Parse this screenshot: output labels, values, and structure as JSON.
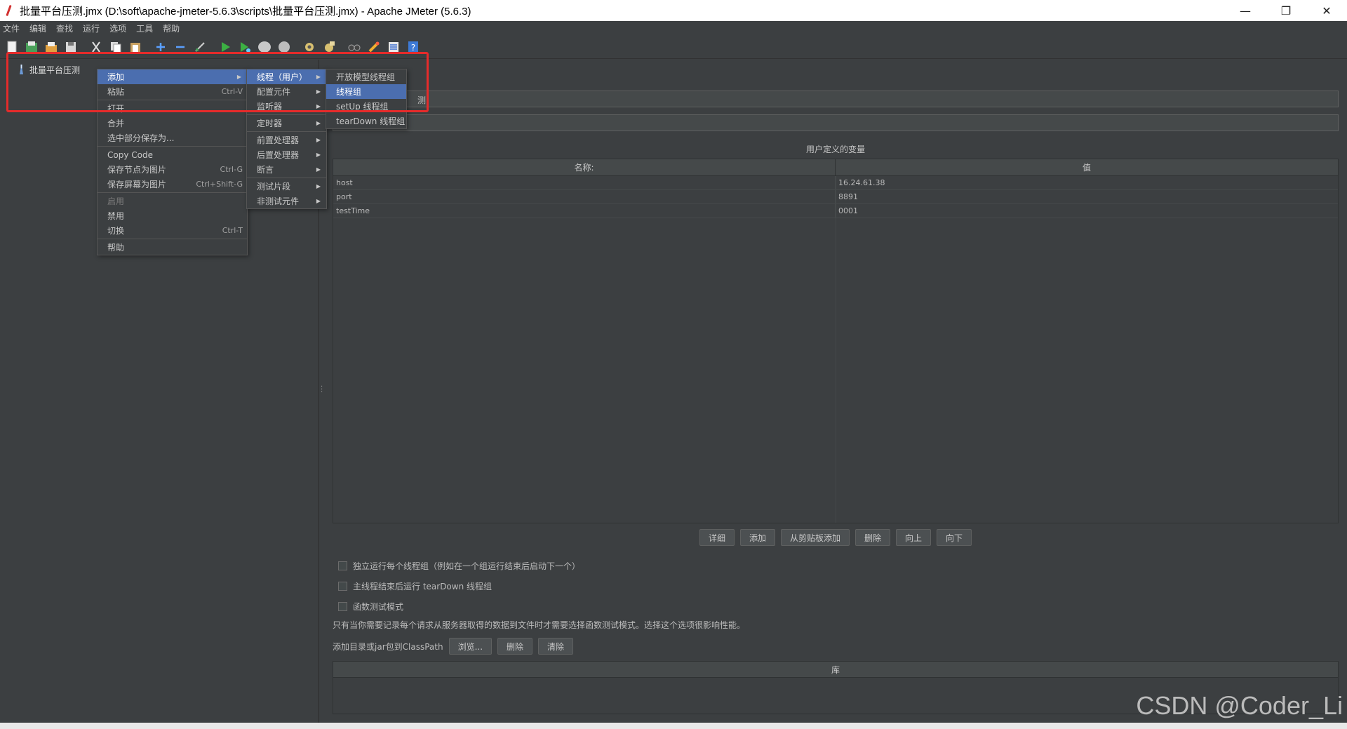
{
  "window": {
    "title": "批量平台压测.jmx (D:\\soft\\apache-jmeter-5.6.3\\scripts\\批量平台压测.jmx) - Apache JMeter (5.6.3)",
    "controls": {
      "minimize": "—",
      "restore": "❐",
      "close": "✕"
    }
  },
  "menubar": [
    "文件",
    "编辑",
    "查找",
    "运行",
    "选项",
    "工具",
    "帮助"
  ],
  "tree": {
    "root_label": "批量平台压测"
  },
  "test_plan": {
    "name_value": "测",
    "section_title": "用户定义的变量",
    "columns": [
      "名称:",
      "值"
    ],
    "rows": [
      {
        "name": "host",
        "value": "16.24.61.38"
      },
      {
        "name": "port",
        "value": "8891"
      },
      {
        "name": "testTime",
        "value": "0001"
      }
    ],
    "buttons": [
      "详细",
      "添加",
      "从剪贴板添加",
      "删除",
      "向上",
      "向下"
    ],
    "checkboxes": [
      "独立运行每个线程组（例如在一个组运行结束后启动下一个）",
      "主线程结束后运行 tearDown 线程组",
      "函数测试模式"
    ],
    "note": "只有当你需要记录每个请求从服务器取得的数据到文件时才需要选择函数测试模式。选择这个选项很影响性能。",
    "classpath_label": "添加目录或jar包到ClassPath",
    "classpath_buttons": [
      "浏览...",
      "删除",
      "清除"
    ],
    "library_header": "库"
  },
  "context_menu": {
    "items": [
      {
        "label": "添加",
        "shortcut": "",
        "selected": true,
        "submenu": true
      },
      {
        "label": "粘贴",
        "shortcut": "Ctrl-V"
      },
      {
        "label": "打开...",
        "shortcut": ""
      },
      {
        "label": "合并",
        "shortcut": ""
      },
      {
        "label": "选中部分保存为...",
        "shortcut": ""
      },
      {
        "label": "Copy Code",
        "shortcut": ""
      },
      {
        "label": "保存节点为图片",
        "shortcut": "Ctrl-G"
      },
      {
        "label": "保存屏幕为图片",
        "shortcut": "Ctrl+Shift-G"
      },
      {
        "label": "启用",
        "shortcut": "",
        "disabled": true
      },
      {
        "label": "禁用",
        "shortcut": ""
      },
      {
        "label": "切换",
        "shortcut": "Ctrl-T"
      },
      {
        "label": "帮助",
        "shortcut": ""
      }
    ]
  },
  "add_submenu": {
    "items": [
      "线程（用户）",
      "配置元件",
      "监听器",
      "定时器",
      "前置处理器",
      "后置处理器",
      "断言",
      "测试片段",
      "非测试元件"
    ]
  },
  "threads_submenu": {
    "items": [
      "开放模型线程组",
      "线程组",
      "setUp 线程组",
      "tearDown 线程组"
    ],
    "selected_index": 1
  },
  "watermark": "CSDN @Coder_Li",
  "colors": {
    "selection": "#4b6eaf",
    "highlight_border": "#e52b2b",
    "background": "#3c3f41"
  }
}
